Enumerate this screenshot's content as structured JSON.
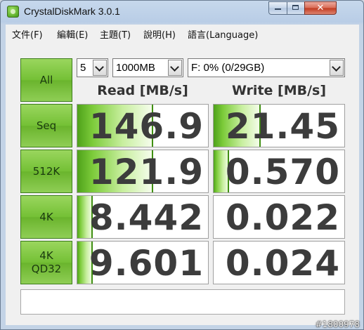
{
  "window": {
    "title": "CrystalDiskMark 3.0.1"
  },
  "caption_buttons": {
    "minimize": "",
    "maximize": "",
    "close": "✕"
  },
  "menu": [
    "文件(F)",
    "編輯(E)",
    "主題(T)",
    "說明(H)",
    "語言(Language)"
  ],
  "controls": {
    "all_label": "All",
    "runs": "5",
    "size": "1000MB",
    "drive": "F: 0% (0/29GB)"
  },
  "headers": {
    "read": "Read [MB/s]",
    "write": "Write [MB/s]"
  },
  "rows": [
    {
      "label": "Seq",
      "read": "146.9",
      "write": "21.45",
      "read_fill": 0.58,
      "write_fill": 0.36
    },
    {
      "label": "512K",
      "read": "121.9",
      "write": "0.570",
      "read_fill": 0.58,
      "write_fill": 0.12
    },
    {
      "label": "4K",
      "read": "8.442",
      "write": "0.022",
      "read_fill": 0.12,
      "write_fill": 0
    },
    {
      "label": "4K\nQD32",
      "read": "9.601",
      "write": "0.024",
      "read_fill": 0.12,
      "write_fill": 0
    }
  ],
  "watermark": "#1800978"
}
